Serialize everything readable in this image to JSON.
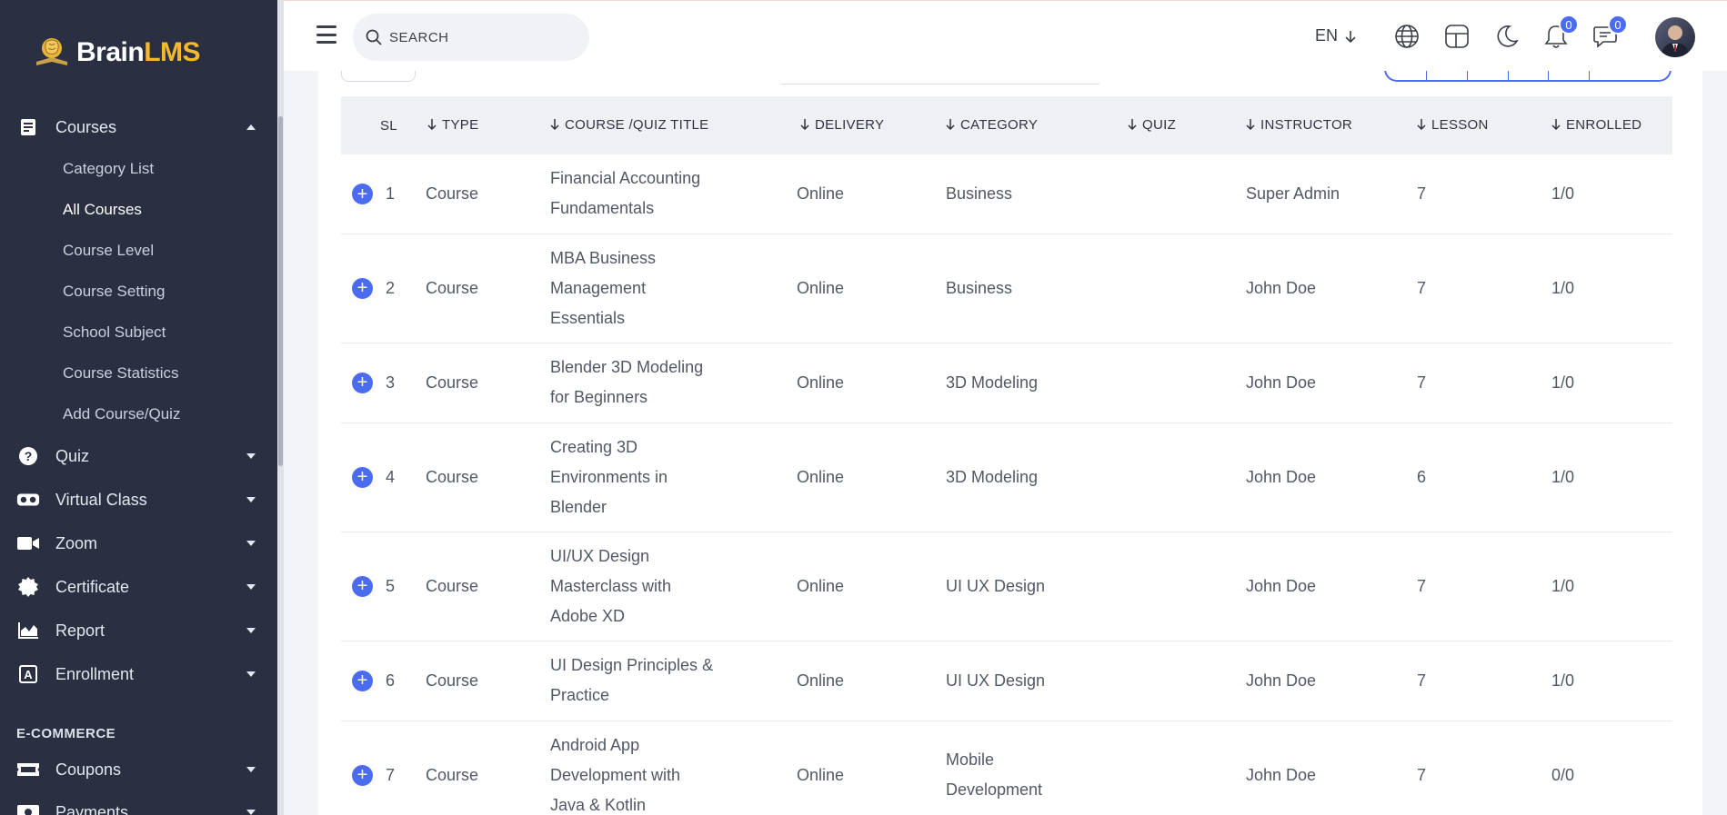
{
  "brand": {
    "part1": "Brain",
    "part2": "LMS"
  },
  "colors": {
    "sidebar_bg": "#2a3042",
    "accent": "#4b6cf0",
    "brand_yellow": "#f5b82e"
  },
  "sidebar": {
    "courses": {
      "label": "Courses",
      "icon": "book-icon",
      "expanded": true,
      "children": [
        {
          "label": "Category List"
        },
        {
          "label": "All Courses",
          "active": true
        },
        {
          "label": "Course Level"
        },
        {
          "label": "Course Setting"
        },
        {
          "label": "School Subject"
        },
        {
          "label": "Course Statistics"
        },
        {
          "label": "Add Course/Quiz"
        }
      ]
    },
    "items": [
      {
        "label": "Quiz",
        "icon": "question-circle-icon"
      },
      {
        "label": "Virtual Class",
        "icon": "vr-headset-icon"
      },
      {
        "label": "Zoom",
        "icon": "video-camera-icon"
      },
      {
        "label": "Certificate",
        "icon": "certificate-badge-icon"
      },
      {
        "label": "Report",
        "icon": "area-chart-icon"
      },
      {
        "label": "Enrollment",
        "icon": "enrollment-icon"
      }
    ],
    "ecommerce_title": "E-COMMERCE",
    "ecommerce_items": [
      {
        "label": "Coupons",
        "icon": "ticket-icon"
      },
      {
        "label": "Payments",
        "icon": "payments-icon"
      }
    ]
  },
  "topbar": {
    "search_placeholder": "SEARCH",
    "language": "EN",
    "notifications_count": "0",
    "messages_count": "0"
  },
  "table": {
    "headers": {
      "sl": "SL",
      "type": "TYPE",
      "title": "COURSE /QUIZ TITLE",
      "delivery": "DELIVERY",
      "category": "CATEGORY",
      "quiz": "QUIZ",
      "instructor": "INSTRUCTOR",
      "lesson": "LESSON",
      "enrolled": "ENROLLED"
    },
    "rows": [
      {
        "sl": "1",
        "type": "Course",
        "title": "Financial Accounting Fundamentals",
        "delivery": "Online",
        "category": "Business",
        "quiz": "",
        "instructor": "Super Admin",
        "lesson": "7",
        "enrolled": "1/0"
      },
      {
        "sl": "2",
        "type": "Course",
        "title": "MBA Business Management Essentials",
        "delivery": "Online",
        "category": "Business",
        "quiz": "",
        "instructor": "John Doe",
        "lesson": "7",
        "enrolled": "1/0"
      },
      {
        "sl": "3",
        "type": "Course",
        "title": "Blender 3D Modeling for Beginners",
        "delivery": "Online",
        "category": "3D Modeling",
        "quiz": "",
        "instructor": "John Doe",
        "lesson": "7",
        "enrolled": "1/0"
      },
      {
        "sl": "4",
        "type": "Course",
        "title": "Creating 3D Environments in Blender",
        "delivery": "Online",
        "category": "3D Modeling",
        "quiz": "",
        "instructor": "John Doe",
        "lesson": "6",
        "enrolled": "1/0"
      },
      {
        "sl": "5",
        "type": "Course",
        "title": "UI/UX Design Masterclass with Adobe XD",
        "delivery": "Online",
        "category": "UI UX Design",
        "quiz": "",
        "instructor": "John Doe",
        "lesson": "7",
        "enrolled": "1/0"
      },
      {
        "sl": "6",
        "type": "Course",
        "title": "UI Design Principles & Practice",
        "delivery": "Online",
        "category": "UI UX Design",
        "quiz": "",
        "instructor": "John Doe",
        "lesson": "7",
        "enrolled": "1/0"
      },
      {
        "sl": "7",
        "type": "Course",
        "title": "Android App Development with Java & Kotlin",
        "delivery": "Online",
        "category": "Mobile Development",
        "quiz": "",
        "instructor": "John Doe",
        "lesson": "7",
        "enrolled": "0/0"
      }
    ]
  }
}
